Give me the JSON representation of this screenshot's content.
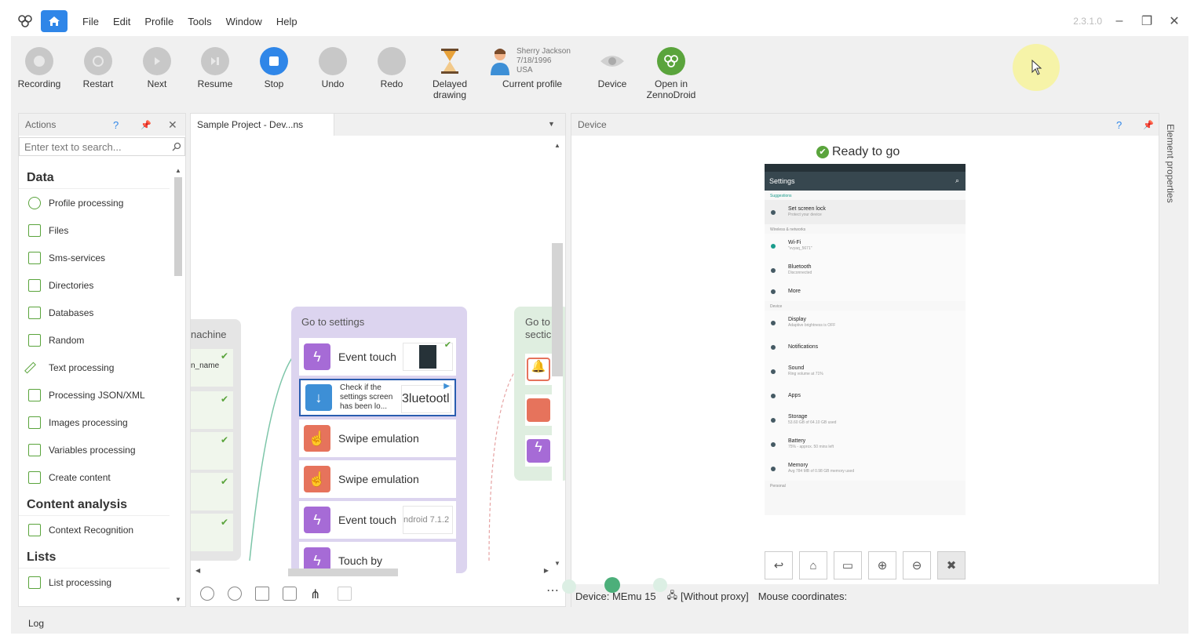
{
  "menu": {
    "items": [
      "File",
      "Edit",
      "Profile",
      "Tools",
      "Window",
      "Help"
    ],
    "version": "2.3.1.0"
  },
  "toolbar": {
    "recording": "Recording",
    "restart": "Restart",
    "next": "Next",
    "resume": "Resume",
    "stop": "Stop",
    "undo": "Undo",
    "redo": "Redo",
    "delayed_line1": "Delayed",
    "delayed_line2": "drawing",
    "profile_name": "Sherry Jackson",
    "profile_dob": "7/18/1996",
    "profile_country": "USA",
    "current_profile": "Current profile",
    "device": "Device",
    "open_line1": "Open in",
    "open_line2": "ZennoDroid"
  },
  "actions": {
    "title": "Actions",
    "search_placeholder": "Enter text to search...",
    "cat_data": "Data",
    "items": [
      "Profile processing",
      "Files",
      "Sms-services",
      "Directories",
      "Databases",
      "Random",
      "Text processing",
      "Processing JSON/XML",
      "Images processing",
      "Variables processing",
      "Create content"
    ],
    "cat_content": "Content analysis",
    "content_items": [
      "Context Recognition"
    ],
    "cat_lists": "Lists",
    "list_items": [
      "List processing"
    ]
  },
  "project": {
    "tab": "Sample Project - Dev...ns",
    "left_group_title": "nachine",
    "left_group_item": "n_name",
    "group_title": "Go to settings",
    "blocks": [
      "Event touch",
      "Check if the settings screen has been lo...",
      "Swipe emulation",
      "Swipe emulation",
      "Event touch",
      "Touch by"
    ],
    "thumb_bluetooth": "3luetootl",
    "thumb_android": "ndroid 7.1.2",
    "right_group_title_1": "Go to",
    "right_group_title_2": "sectic"
  },
  "device": {
    "title": "Device",
    "ready": "Ready to go",
    "phone": {
      "title": "Settings",
      "suggestions": "Suggestions",
      "lock": "Set screen lock",
      "lock_sub": "Protect your device",
      "wireless": "Wireless & networks",
      "wifi": "Wi-Fi",
      "wifi_sub": "\"vvyaq_5671\"",
      "bluetooth": "Bluetooth",
      "bluetooth_sub": "Disconnected",
      "more": "More",
      "device_sec": "Device",
      "display": "Display",
      "display_sub": "Adaptive brightness is OFF",
      "notifications": "Notifications",
      "sound": "Sound",
      "sound_sub": "Ring volume at 71%",
      "apps": "Apps",
      "storage": "Storage",
      "storage_sub": "53.60 GB of 64.10 GB used",
      "battery": "Battery",
      "battery_sub": "75% - approx. 50 mins left",
      "memory": "Memory",
      "memory_sub": "Avg 784 MB of 0.98 GB memory used",
      "personal": "Personal"
    },
    "status_device": "Device: MEmu 15",
    "status_proxy": "[Without proxy]",
    "status_mouse": "Mouse coordinates:"
  },
  "side": {
    "label": "Element properties"
  },
  "log": {
    "label": "Log"
  },
  "colors": {
    "accent": "#2f86e8",
    "green": "#5aa43c",
    "purple": "#a66bd6",
    "orange": "#e6735c"
  }
}
